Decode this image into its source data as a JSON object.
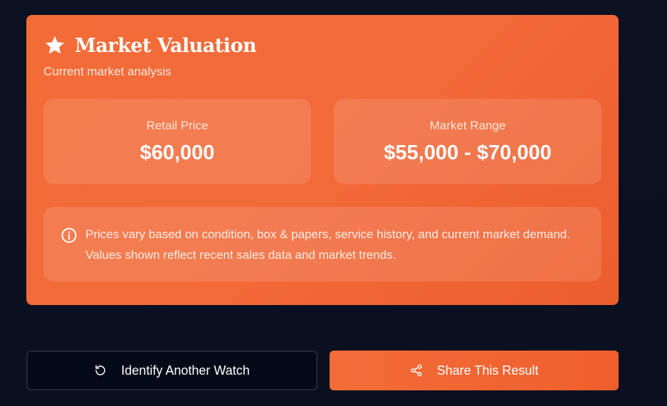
{
  "valuation": {
    "title": "Market Valuation",
    "subtitle": "Current market analysis",
    "title_icon": "star-icon",
    "retail": {
      "label": "Retail Price",
      "value": "$60,000"
    },
    "market": {
      "label": "Market Range",
      "value": "$55,000 - $70,000"
    },
    "note": {
      "icon": "info-icon",
      "text": "Prices vary based on condition, box & papers, service history, and current market demand. Values shown reflect recent sales data and market trends."
    }
  },
  "actions": {
    "identify_label": "Identify Another Watch",
    "identify_icon": "refresh-icon",
    "share_label": "Share This Result",
    "share_icon": "share-icon"
  },
  "colors": {
    "accent": "#f36c38",
    "background": "#0b1120",
    "secondary_button": "#040a18"
  }
}
